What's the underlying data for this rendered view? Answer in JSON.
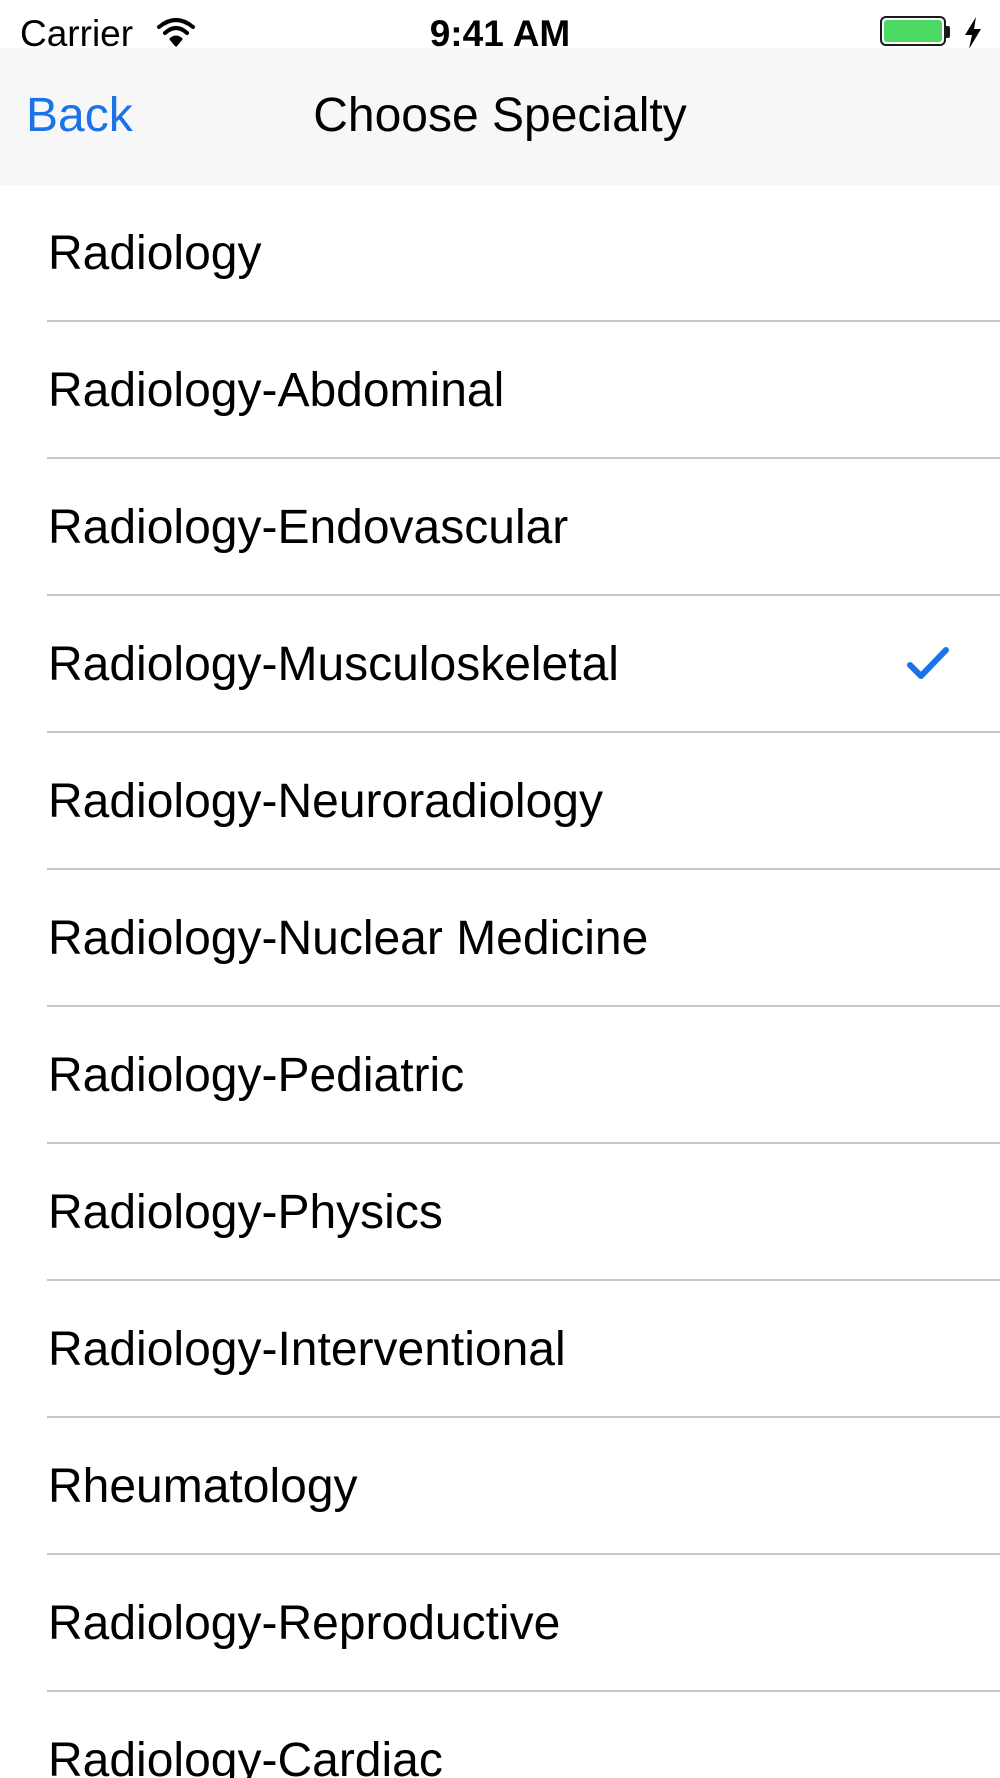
{
  "status_bar": {
    "carrier": "Carrier",
    "time": "9:41 AM",
    "wifi_icon": "wifi-icon",
    "battery_icon": "battery-icon",
    "charging_icon": "bolt-icon",
    "battery_color": "#4cd964"
  },
  "nav": {
    "back_label": "Back",
    "title": "Choose Specialty",
    "accent_color": "#1a73e8"
  },
  "specialties": {
    "items": [
      {
        "label": "Radiology",
        "selected": false
      },
      {
        "label": "Radiology-Abdominal",
        "selected": false
      },
      {
        "label": "Radiology-Endovascular",
        "selected": false
      },
      {
        "label": "Radiology-Musculoskeletal",
        "selected": true
      },
      {
        "label": "Radiology-Neuroradiology",
        "selected": false
      },
      {
        "label": "Radiology-Nuclear Medicine",
        "selected": false
      },
      {
        "label": "Radiology-Pediatric",
        "selected": false
      },
      {
        "label": "Radiology-Physics",
        "selected": false
      },
      {
        "label": "Radiology-Interventional",
        "selected": false
      },
      {
        "label": "Rheumatology",
        "selected": false
      },
      {
        "label": "Radiology-Reproductive",
        "selected": false
      },
      {
        "label": "Radiology-Cardiac",
        "selected": false
      }
    ],
    "check_icon": "checkmark-icon"
  }
}
